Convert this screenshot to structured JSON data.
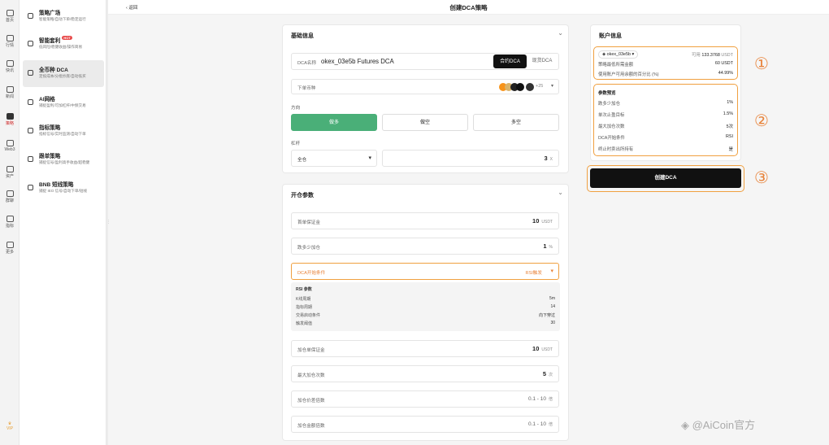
{
  "rail": {
    "items": [
      {
        "label": "首页",
        "icon": "home-icon"
      },
      {
        "label": "行情",
        "icon": "chart-icon"
      },
      {
        "label": "快讯",
        "icon": "news-icon"
      },
      {
        "label": "新闻",
        "icon": "article-icon"
      },
      {
        "label": "策略",
        "icon": "robot-icon"
      },
      {
        "label": "Web3",
        "icon": "web3-icon"
      },
      {
        "label": "资产",
        "icon": "wallet-icon"
      },
      {
        "label": "群聊",
        "icon": "chat-icon"
      },
      {
        "label": "指标",
        "icon": "indicator-icon"
      },
      {
        "label": "更多",
        "icon": "more-icon"
      }
    ],
    "vip": "VIP"
  },
  "sidebar": {
    "items": [
      {
        "title": "策略广场",
        "sub": "智能策略/自动下单/稳定运行"
      },
      {
        "title": "智能套利",
        "badge": "HOT",
        "sub": "低风险/稳健收益/操作简易"
      },
      {
        "title": "全币种 DCA",
        "sub": "定投成本/分批抄底/自动低买"
      },
      {
        "title": "AI网格",
        "sub": "捕捉盈利/可加杠杆/中频交易"
      },
      {
        "title": "指标策略",
        "sub": "指标信号/实时监测/自动下单"
      },
      {
        "title": "跟单策略",
        "sub": "捕捉信号/盈利高手收益/超稳健"
      },
      {
        "title": "BNB 短线策略",
        "sub": "捕捉 IEO 信号/自动下单/短线"
      }
    ]
  },
  "header": {
    "back": "返回",
    "title": "创建DCA策略"
  },
  "basic": {
    "title": "基础信息",
    "name_label": "DCA名称",
    "name_value": "okex_03e5b Futures DCA",
    "tabs": [
      "合约DCA",
      "现货DCA"
    ],
    "coin_label": "下单币种",
    "coin_more": "+25",
    "direction_label": "方向",
    "directions": [
      "做多",
      "做空",
      "多空"
    ],
    "leverage_label": "杠杆",
    "margin_mode": "全仓",
    "leverage_value": "3",
    "leverage_unit": "X"
  },
  "open": {
    "title": "开仓参数",
    "fields": [
      {
        "label": "首单保证金",
        "value": "10",
        "unit": "USDT"
      },
      {
        "label": "跌多少加仓",
        "value": "1",
        "unit": "%"
      }
    ],
    "trigger": {
      "label": "DCA开始条件",
      "value": "RSI触发"
    },
    "rsi": {
      "title": "RSI 参数",
      "rows": [
        {
          "k": "K线周期",
          "v": "5m"
        },
        {
          "k": "指标周期",
          "v": "14"
        },
        {
          "k": "交易启动条件",
          "v": "向下穿过"
        },
        {
          "k": "触发阈值",
          "v": "30"
        }
      ]
    },
    "more": [
      {
        "label": "加仓单保证金",
        "value": "10",
        "unit": "USDT"
      },
      {
        "label": "最大加仓次数",
        "value": "5",
        "unit": "次"
      },
      {
        "label": "加仓价差倍数",
        "value": "0.1 - 10",
        "unit": "倍"
      },
      {
        "label": "加仓金额倍数",
        "value": "0.1 - 10",
        "unit": "倍"
      }
    ]
  },
  "account": {
    "title": "账户信息",
    "account_name": "okex_03e5b",
    "available_label": "可用",
    "available_value": "133.3768",
    "available_unit": "USDT",
    "rows": [
      {
        "k": "策略最低所需金额",
        "v": "60 USDT"
      },
      {
        "k": "使用账户可用余额的百分比 (%)",
        "v": "44.99%"
      }
    ],
    "preview_title": "参数预览",
    "preview": [
      {
        "k": "跌多少加仓",
        "v": "1%"
      },
      {
        "k": "单次止盈目标",
        "v": "1.5%"
      },
      {
        "k": "最大加仓次数",
        "v": "5次"
      },
      {
        "k": "DCA开始条件",
        "v": "RSI"
      },
      {
        "k": "终止时卖出所持有",
        "v": "是"
      }
    ],
    "create": "创建DCA"
  },
  "annotations": [
    "①",
    "②",
    "③"
  ],
  "watermark": "◈ @AiCoin官方"
}
